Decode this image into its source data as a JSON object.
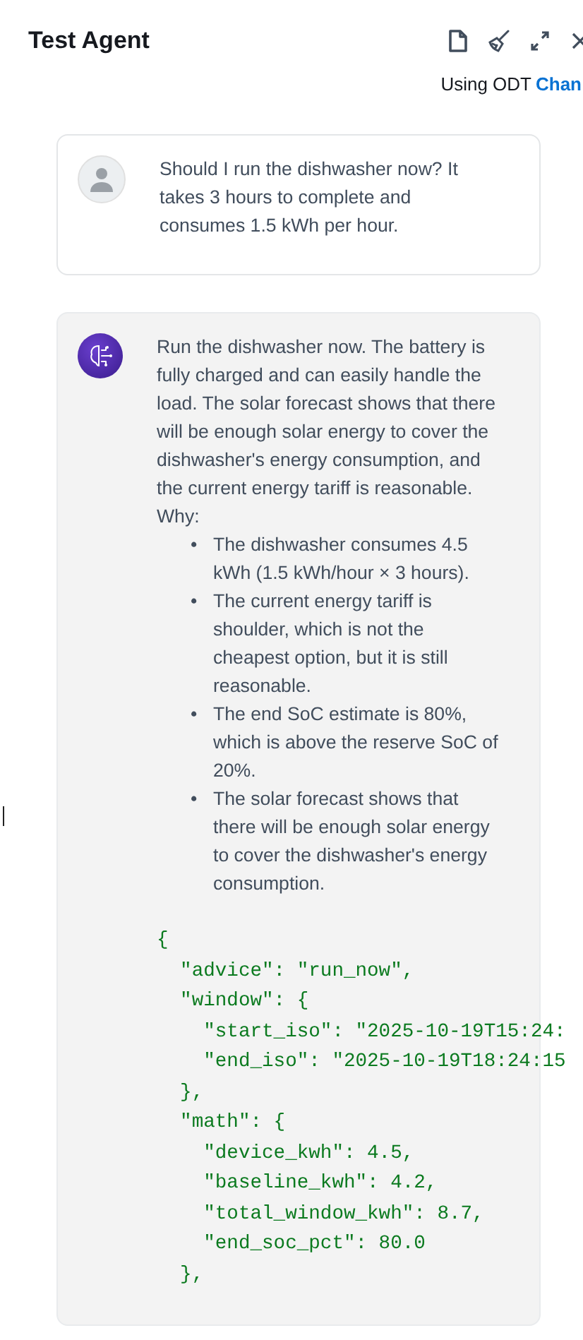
{
  "header": {
    "title": "Test Agent",
    "status_text": "Using ODT",
    "status_link": "Chan"
  },
  "messages": [
    {
      "kind": "user",
      "text": "Should I run the dishwasher now? It takes 3 hours to complete and consumes 1.5 kWh per hour."
    },
    {
      "kind": "agent",
      "paragraph": "Run the dishwasher now. The battery is fully charged and can easily handle the load. The solar forecast shows that there will be enough solar energy to cover the dishwasher's energy consumption, and the current energy tariff is reasonable.",
      "why_label": "Why:",
      "bullets": [
        {
          "marker": "•",
          "text": "The dishwasher consumes 4.5 kWh (1.5 kWh/hour × 3 hours)."
        },
        {
          "marker": "•",
          "text": "The current energy tariff is shoulder, which is not the cheapest option, but it is still reasonable."
        },
        {
          "marker": "•",
          "text": "The end SoC estimate is 80%, which is above the reserve SoC of 20%."
        },
        {
          "marker": "•",
          "text": "The solar forecast shows that there will be enough solar energy to cover the dishwasher's energy consumption."
        }
      ],
      "code_lines": [
        "{",
        "  \"advice\": \"run_now\",",
        "  \"window\": {",
        "    \"start_iso\": \"2025-10-19T15:24:",
        "    \"end_iso\": \"2025-10-19T18:24:15",
        "  },",
        "  \"math\": {",
        "    \"device_kwh\": 4.5,",
        "    \"baseline_kwh\": 4.2,",
        "    \"total_window_kwh\": 8.7,",
        "    \"end_soc_pct\": 80.0",
        "  },"
      ]
    }
  ]
}
